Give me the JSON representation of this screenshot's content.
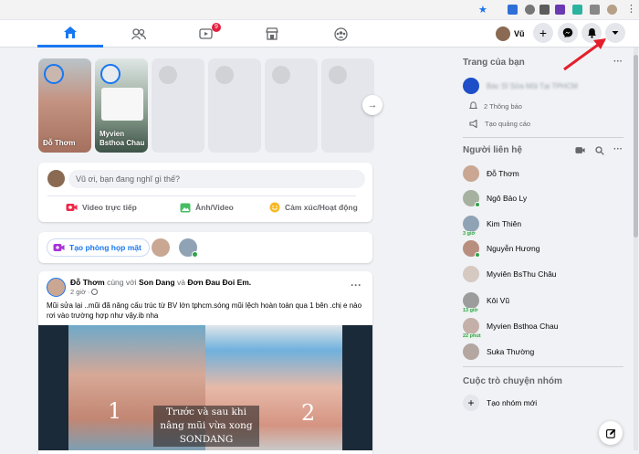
{
  "nav": {
    "video_badge": "9",
    "profile_name": "Vũ"
  },
  "stories": [
    {
      "name": "Đỗ Thơm"
    },
    {
      "name": "Myvien Bsthoa Chau"
    }
  ],
  "composer": {
    "placeholder": "Vũ ơi, bạn đang nghĩ gì thế?",
    "live_label": "Video trực tiếp",
    "photo_label": "Ảnh/Video",
    "feeling_label": "Cảm xúc/Hoạt động"
  },
  "rooms": {
    "create_label": "Tạo phòng họp mặt"
  },
  "post": {
    "author": "Đỗ Thơm",
    "with_text": "cùng với",
    "tag1": "Son Dang",
    "and_text": "và",
    "tag2": "Đơn Đau Đoi Em.",
    "time": "2 giờ · ",
    "body": "Mũi sửa lại ..mũi đã nâng cấu trúc từ BV lớn tphcm.sóng mũi lệch hoàn toàn qua 1 bên .chị e nào rơi vào trường hợp như vậy.ib nha",
    "img_num1": "1",
    "img_num2": "2",
    "img_caption_line1": "Trước và sau khi",
    "img_caption_line2": "nâng mũi vừa xong",
    "img_caption_line3": "SONDANG",
    "more": "···"
  },
  "right": {
    "pages_title": "Trang của bạn",
    "pages_more": "···",
    "page_name": "Bác Sĩ Sửa Mũi Tại TPHCM",
    "notifications": "2 Thông báo",
    "create_ad": "Tạo quảng cáo",
    "contacts_title": "Người liên hệ",
    "contacts_more": "···",
    "contacts": [
      {
        "name": "Đỗ Thơm",
        "status": "",
        "color": "#c9a793"
      },
      {
        "name": "Ngô Bảo Ly",
        "status": "",
        "color": "#a7b1a0"
      },
      {
        "name": "Kim Thiên",
        "status": "3 giờ",
        "color": "#8fa3b5"
      },
      {
        "name": "Nguyễn Hương",
        "status": "",
        "color": "#b88f7f"
      },
      {
        "name": "Myviên BsThu Châu",
        "status": "",
        "color": "#d6c9c2"
      },
      {
        "name": "Kôi Vũ",
        "status": "13 giờ",
        "color": "#9c9c9c"
      },
      {
        "name": "Myvien Bsthoa Chau",
        "status": "22 phút",
        "color": "#c4b0a8"
      },
      {
        "name": "Suka Thường",
        "status": "",
        "color": "#b4a6a1"
      }
    ],
    "groups_title": "Cuộc trò chuyện nhóm",
    "create_group": "Tạo nhóm mới"
  },
  "colors": {
    "accent": "#1877f2",
    "arrow": "#e41e2a",
    "online": "#31a24c"
  }
}
